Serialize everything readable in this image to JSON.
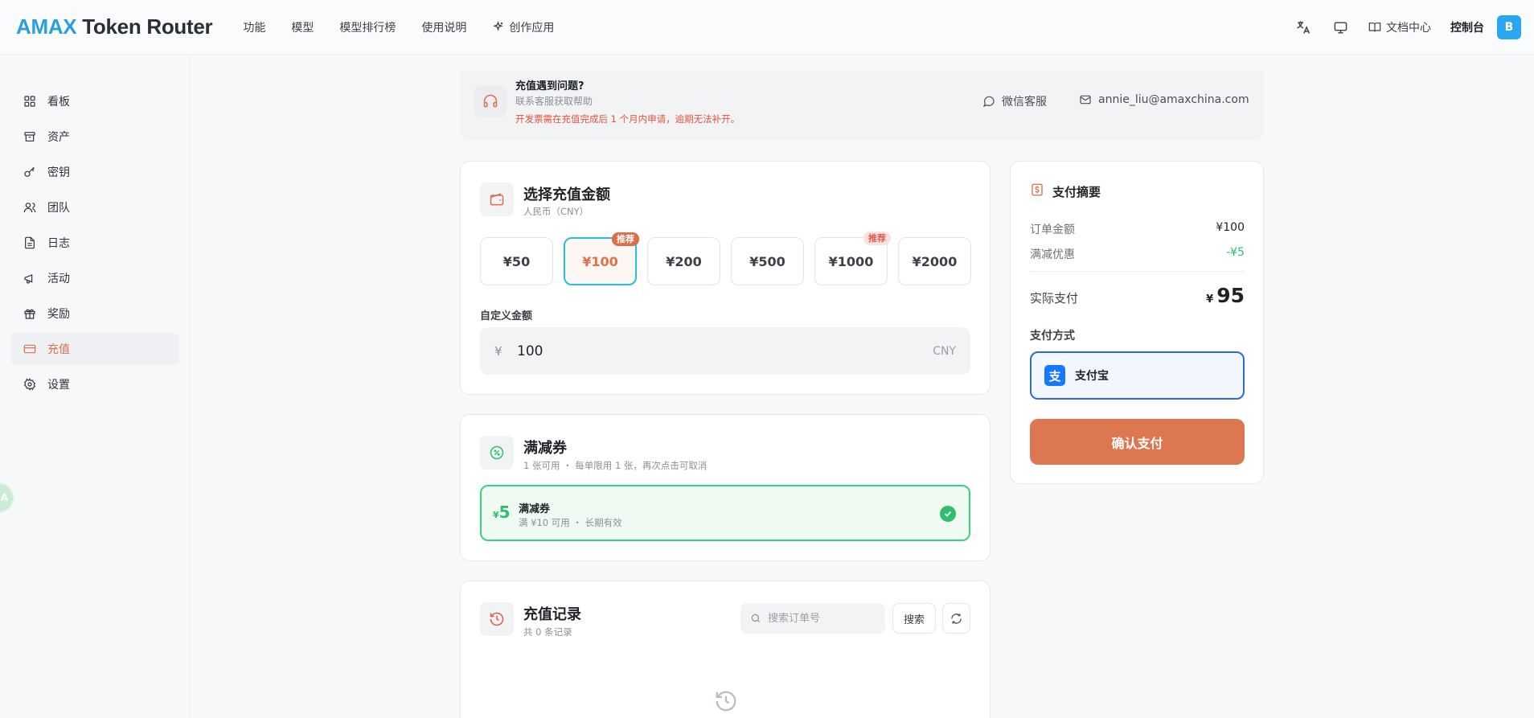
{
  "brand": {
    "prefix": "AMAX",
    "rest": " Token Router"
  },
  "topnav": [
    {
      "label": "功能"
    },
    {
      "label": "模型"
    },
    {
      "label": "模型排行榜"
    },
    {
      "label": "使用说明"
    },
    {
      "label": "创作应用"
    }
  ],
  "topright": {
    "docs": "文档中心",
    "console": "控制台",
    "avatar": "B"
  },
  "sidebar": [
    {
      "label": "看板"
    },
    {
      "label": "资产"
    },
    {
      "label": "密钥"
    },
    {
      "label": "团队"
    },
    {
      "label": "日志"
    },
    {
      "label": "活动"
    },
    {
      "label": "奖励"
    },
    {
      "label": "充值",
      "active": true
    },
    {
      "label": "设置"
    }
  ],
  "float_badge": "A",
  "help": {
    "title": "充值遇到问题?",
    "subtitle": "联系客服获取帮助",
    "warning": "开发票需在充值完成后 1 个月内申请，逾期无法补开。",
    "wechat": "微信客服",
    "email": "annie_liu@amaxchina.com"
  },
  "amount_card": {
    "title": "选择充值金额",
    "subtitle": "人民币（CNY）",
    "options": [
      {
        "label": "¥50"
      },
      {
        "label": "¥100",
        "tag": "推荐",
        "selected": true
      },
      {
        "label": "¥200"
      },
      {
        "label": "¥500"
      },
      {
        "label": "¥1000",
        "tag": "推荐"
      },
      {
        "label": "¥2000"
      }
    ],
    "custom_label": "自定义金额",
    "custom_currency": "¥",
    "custom_value": "100",
    "custom_unit": "CNY"
  },
  "coupon_card": {
    "title": "满减券",
    "subtitle": "1 张可用 ・ 每单限用 1 张，再次点击可取消",
    "coupon": {
      "currency": "¥",
      "value": "5",
      "name": "满减券",
      "desc": "满 ¥10 可用 ・ 长期有效"
    }
  },
  "records_card": {
    "title": "充值记录",
    "subtitle": "共 0 条记录",
    "search_placeholder": "搜索订单号",
    "search_button": "搜索"
  },
  "summary": {
    "title": "支付摘要",
    "order_label": "订单金额",
    "order_value": "¥100",
    "discount_label": "满减优惠",
    "discount_value": "-¥5",
    "actual_label": "实际支付",
    "actual_currency": "¥",
    "actual_value": "95",
    "method_label": "支付方式",
    "method_name": "支付宝",
    "confirm": "确认支付"
  },
  "colors": {
    "accent": "#dd7752",
    "brand": "#2a9fdc",
    "selected_border": "#22c3d9",
    "coupon_green": "#2fbf6e",
    "pay_blue": "#2b6cd9"
  }
}
